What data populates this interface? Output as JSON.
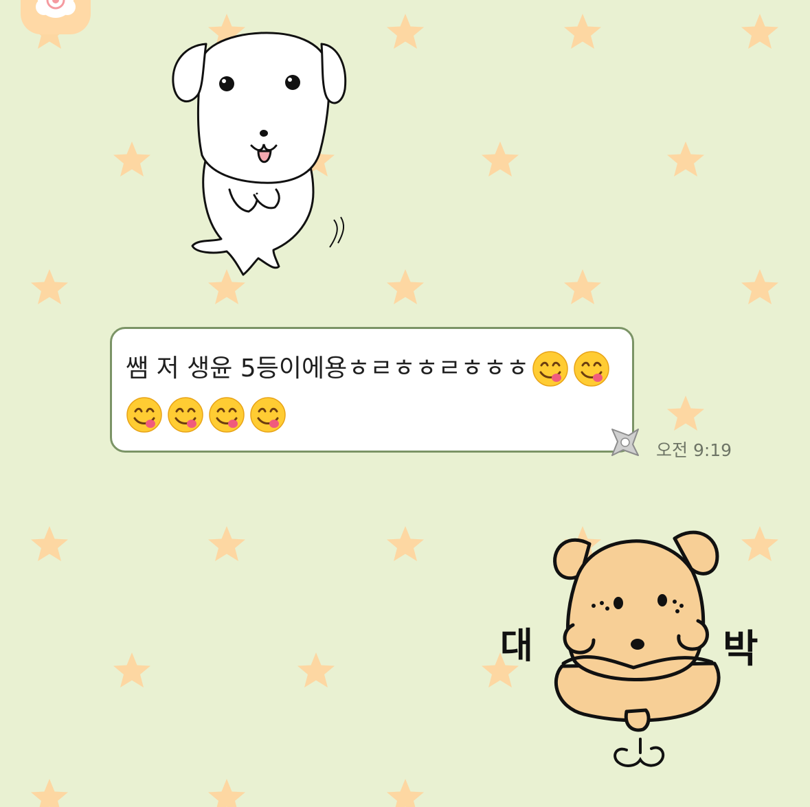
{
  "chat": {
    "message": {
      "text": "쌤 저 생윤 5등이에용ㅎㄹㅎㅎㄹㅎㅎㅎ",
      "emoji_line1_count": 2,
      "emoji_line2_count": 4,
      "emoji_name": "face-savoring-food",
      "time": "오전 9:19"
    },
    "sticker_bottom": {
      "left_text": "대",
      "right_text": "박"
    }
  },
  "colors": {
    "background": "#e9f1d2",
    "star": "#fdd7a2",
    "bubble_border": "#7b9466",
    "bubble_fill": "#ffffff",
    "time_text": "#6e7566",
    "bear_fill": "#f7cf96",
    "avatar_fill": "#ffd9a6"
  }
}
